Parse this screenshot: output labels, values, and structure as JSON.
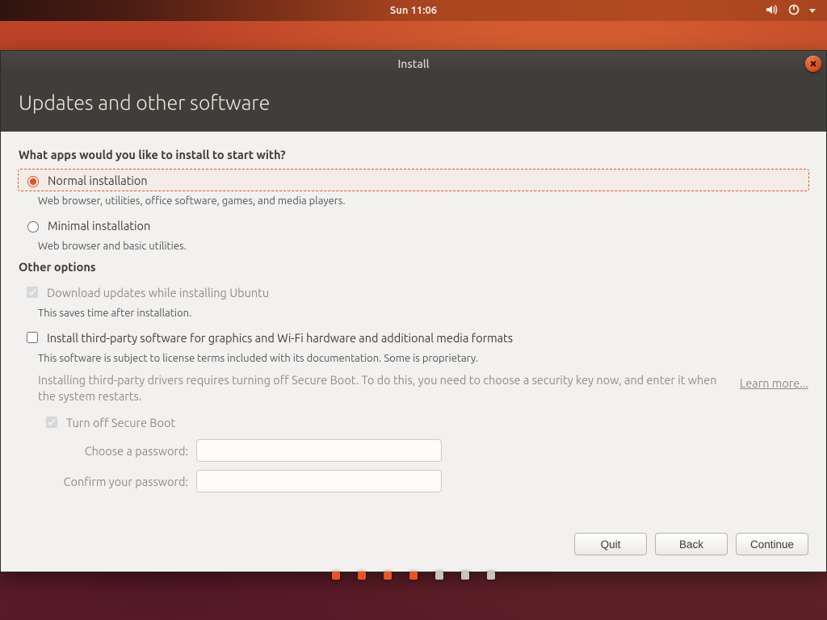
{
  "topbar": {
    "clock": "Sun 11:06"
  },
  "window": {
    "title": "Install",
    "page_title": "Updates and other software",
    "question": "What apps would you like to install to start with?",
    "options": {
      "normal": {
        "label": "Normal installation",
        "desc": "Web browser, utilities, office software, games, and media players."
      },
      "minimal": {
        "label": "Minimal installation",
        "desc": "Web browser and basic utilities."
      }
    },
    "other_title": "Other options",
    "download_updates": {
      "label": "Download updates while installing Ubuntu",
      "desc": "This saves time after installation."
    },
    "third_party": {
      "label": "Install third-party software for graphics and Wi-Fi hardware and additional media formats",
      "desc": "This software is subject to license terms included with its documentation. Some is proprietary."
    },
    "secure_info": "Installing third-party drivers requires turning off Secure Boot. To do this, you need to choose a security key now, and enter it when the system restarts.",
    "learn_more": "Learn more...",
    "secure_boot": {
      "label": "Turn off Secure Boot",
      "pw_label": "Choose a password:",
      "confirm_label": "Confirm your password:"
    },
    "buttons": {
      "quit": "Quit",
      "back": "Back",
      "continue": "Continue"
    }
  },
  "progress": {
    "total": 7,
    "current": 4
  }
}
